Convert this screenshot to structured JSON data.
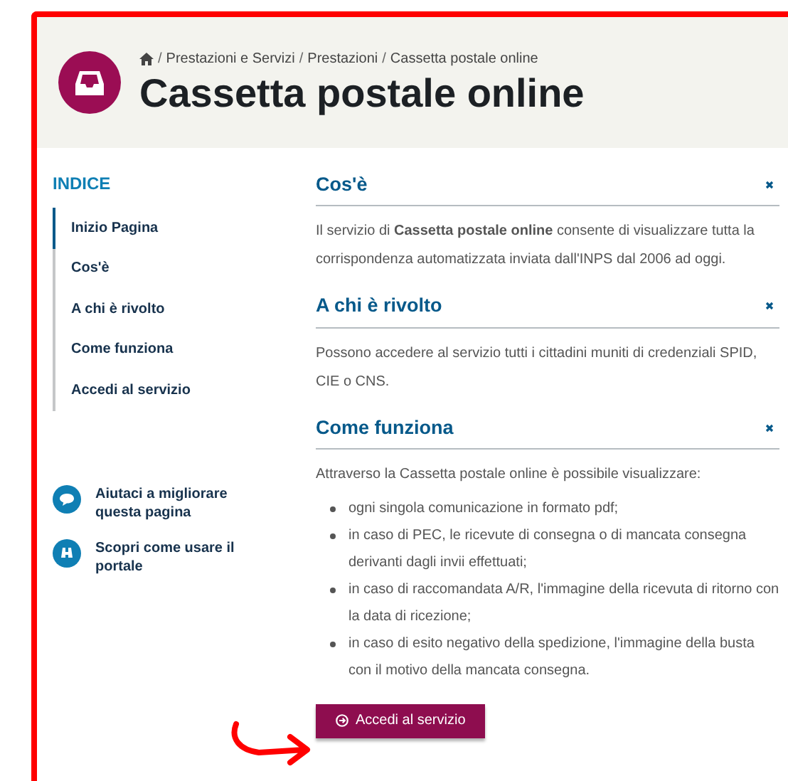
{
  "breadcrumb_separator": "/",
  "breadcrumb": [
    "Prestazioni e Servizi",
    "Prestazioni",
    "Cassetta postale online"
  ],
  "title": "Cassetta postale online",
  "index": {
    "heading": "INDICE",
    "items": [
      {
        "label": "Inizio Pagina",
        "selected": true
      },
      {
        "label": "Cos'è",
        "selected": false
      },
      {
        "label": "A chi è rivolto",
        "selected": false
      },
      {
        "label": "Come funziona",
        "selected": false
      },
      {
        "label": "Accedi al servizio",
        "selected": false
      }
    ]
  },
  "help_links": [
    {
      "kind": "feedback",
      "label": "Aiutaci a migliorare questa pagina"
    },
    {
      "kind": "guide",
      "label": "Scopri come usare il portale"
    }
  ],
  "sections": [
    {
      "heading": "Cos'è",
      "paragraph": "Il servizio di **Cassetta postale online** consente di visualizzare tutta la corrispondenza automatizzata inviata dall'INPS dal 2006 ad oggi."
    },
    {
      "heading": "A chi è rivolto",
      "paragraph": "Possono accedere al servizio tutti i cittadini muniti di credenziali SPID, CIE o CNS."
    },
    {
      "heading": "Come funziona",
      "paragraph": "Attraverso la Cassetta postale online è possibile visualizzare:",
      "bullets": [
        "ogni singola comunicazione in formato pdf;",
        "in caso di PEC, le ricevute di consegna o di mancata consegna derivanti dagli invii effettuati;",
        "in caso di raccomandata A/R, l'immagine della ricevuta di ritorno con la data di ricezione;",
        "in caso di esito negativo della spedizione, l'immagine della busta con il motivo della mancata consegna."
      ]
    }
  ],
  "button": {
    "label": "Accedi al servizio"
  }
}
